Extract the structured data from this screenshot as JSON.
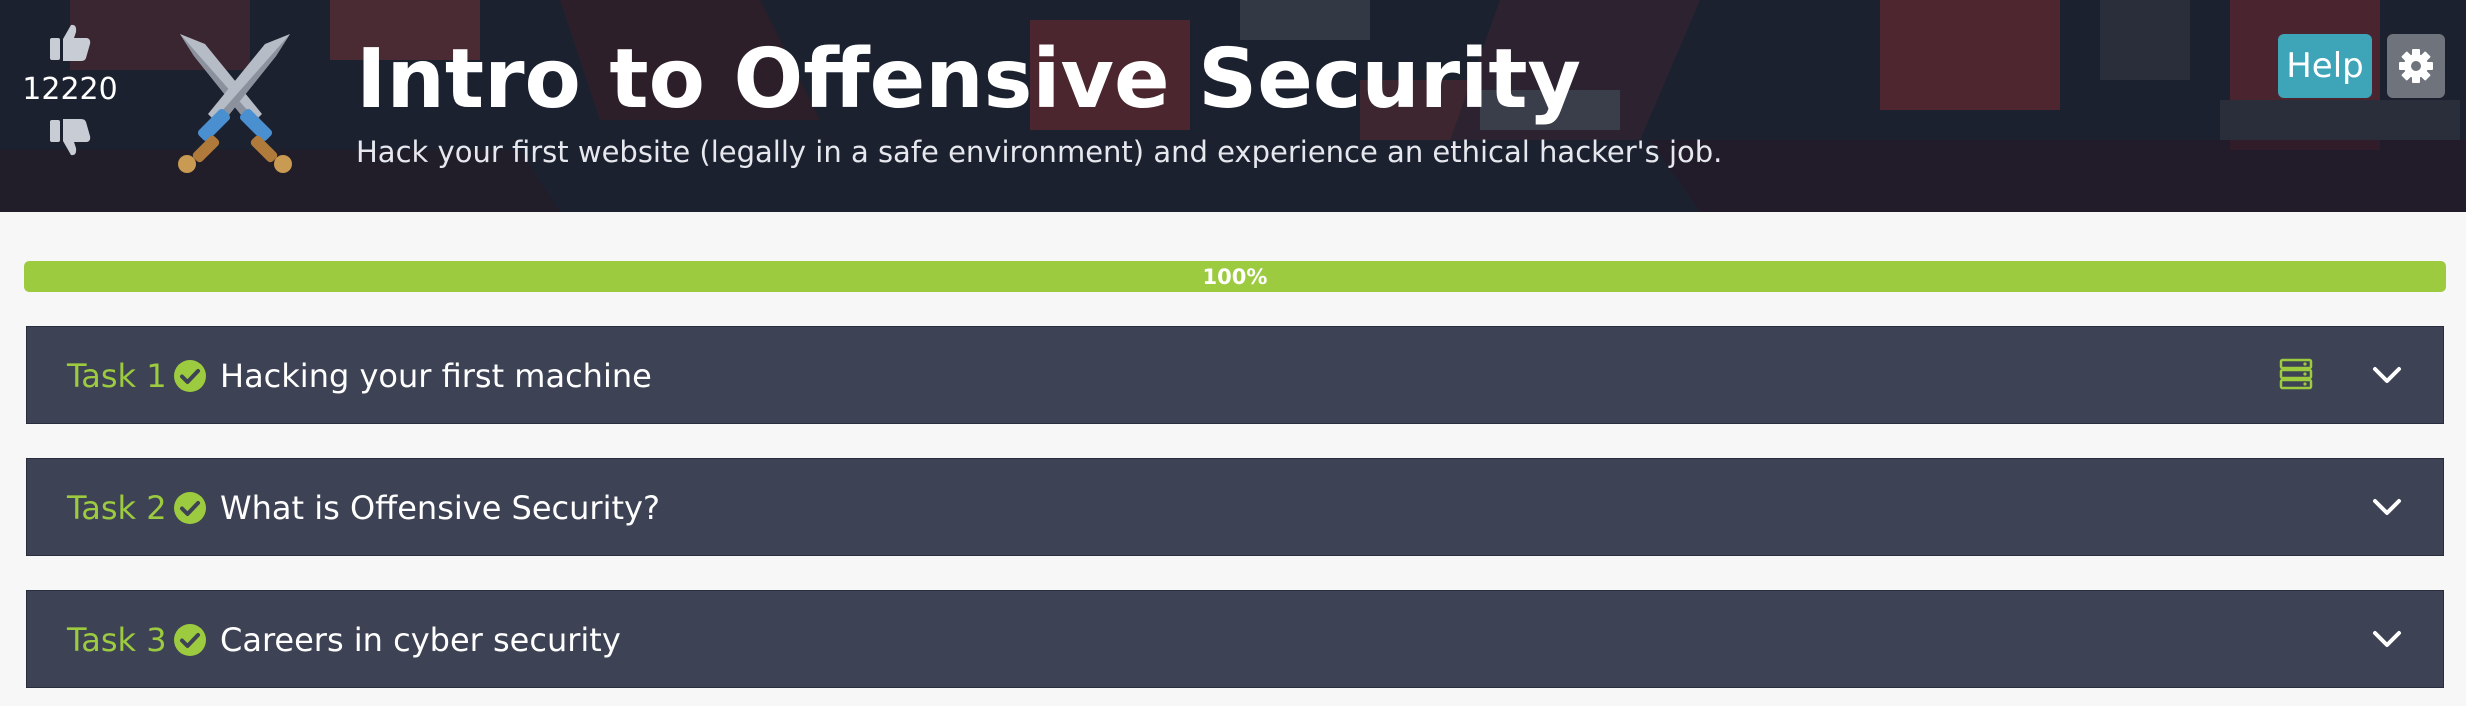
{
  "header": {
    "title": "Intro to Offensive Security",
    "subtitle": "Hack your first website (legally in a safe environment) and experience an ethical hacker's job.",
    "vote_score": "12220",
    "help_label": "Help",
    "icons": {
      "upvote": "thumbs-up-icon",
      "downvote": "thumbs-down-icon",
      "room": "crossed-swords-icon",
      "settings": "gear-icon"
    }
  },
  "progress": {
    "percent": 100,
    "label": "100%"
  },
  "tasks": [
    {
      "number": "Task 1",
      "title": "Hacking your first machine",
      "completed": true,
      "has_machine": true
    },
    {
      "number": "Task 2",
      "title": "What is Offensive Security?",
      "completed": true,
      "has_machine": false
    },
    {
      "number": "Task 3",
      "title": "Careers in cyber security",
      "completed": true,
      "has_machine": false
    }
  ],
  "colors": {
    "accent_green": "#9ccb3f",
    "help_blue": "#3ea4b8",
    "task_bg": "#3d4254",
    "header_bg": "#1c2130"
  }
}
